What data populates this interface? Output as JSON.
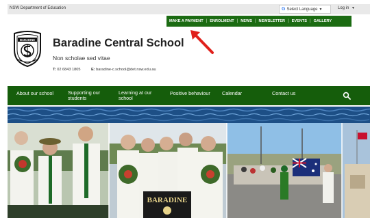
{
  "topbar": {
    "department": "NSW Department of Education",
    "language": "Select Language",
    "login": "Log in"
  },
  "quicknav": [
    "MAKE A PAYMENT",
    "ENROLMENT",
    "NEWS",
    "NEWSLETTER",
    "EVENTS",
    "GALLERY"
  ],
  "school": {
    "name": "Baradine Central School",
    "motto": "Non scholae sed vitae",
    "phone_label": "T:",
    "phone": "02 6843 1805",
    "email_label": "E:",
    "email": "baradine-c.school@det.nsw.edu.au",
    "logo_text": "BARADINE"
  },
  "mainnav": [
    {
      "label": "About our school"
    },
    {
      "label": "Supporting our students"
    },
    {
      "label": "Learning at our school"
    },
    {
      "label": "Positive behaviour"
    },
    {
      "label": "Calendar"
    },
    {
      "label": "Contact us"
    }
  ],
  "banner": {
    "sign_text": "BARADINE"
  },
  "colors": {
    "nav_green": "#155d0b",
    "quick_green": "#1b6b12",
    "arrow_red": "#e0201b",
    "water_blue": "#1d4f86"
  },
  "icons": {
    "search": "search-icon",
    "arrow": "red-arrow",
    "flag": "australian-flag"
  }
}
